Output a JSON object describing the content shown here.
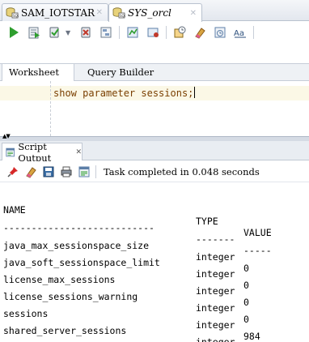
{
  "doc_tabs": [
    {
      "label": "SAM_IOTSTAR",
      "icon": "database-connection-icon"
    },
    {
      "label": "SYS_orcl",
      "icon": "database-connection-icon"
    }
  ],
  "editor_tabs": [
    "Worksheet",
    "Query Builder"
  ],
  "editor": {
    "code": "show parameter sessions;"
  },
  "output_panel": {
    "tab_label": "Script Output",
    "status": "Task completed in 0.048 seconds"
  },
  "output": {
    "headers": [
      "NAME",
      "TYPE",
      "VALUE"
    ],
    "separators": [
      "---------------------------",
      "-------",
      "-----"
    ],
    "rows": [
      [
        "java_max_sessionspace_size",
        "integer",
        "0"
      ],
      [
        "java_soft_sessionspace_limit",
        "integer",
        "0"
      ],
      [
        "license_max_sessions",
        "integer",
        "0"
      ],
      [
        "license_sessions_warning",
        "integer",
        "0"
      ],
      [
        "sessions",
        "integer",
        "984"
      ],
      [
        "shared_server_sessions",
        "integer",
        ""
      ]
    ]
  },
  "colors": {
    "run_green": "#2e9e2e",
    "code_text": "#7a3f00",
    "line_highlight": "#fbf8e6"
  }
}
